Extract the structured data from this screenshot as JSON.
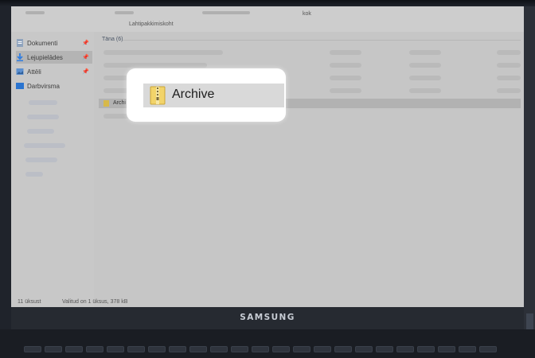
{
  "device": {
    "brand": "SAMSUNG"
  },
  "explorer": {
    "address": {
      "crumb": "Lahtipakkimiskoht",
      "right_label": "kok"
    },
    "sidebar": {
      "items": [
        {
          "label": "Dokumenti",
          "icon": "documents-icon",
          "pinned": true
        },
        {
          "label": "Lejupielādes",
          "icon": "download-icon",
          "pinned": true,
          "active": true
        },
        {
          "label": "Attēli",
          "icon": "pictures-icon",
          "pinned": true
        },
        {
          "label": "Darbvirsma",
          "icon": "desktop-icon",
          "pinned": false
        }
      ]
    },
    "group_header": "Täna (6)",
    "selected_file": "Archi",
    "status": {
      "count": "11 üksust",
      "selection": "Valitud on 1 üksus, 378 kB"
    }
  },
  "callout": {
    "label": "Archive",
    "icon": "zip-folder-icon"
  },
  "colors": {
    "dim_overlay": "#c6c6c6",
    "download_blue": "#2f7de1",
    "zip_yellow": "#e8c14a"
  }
}
